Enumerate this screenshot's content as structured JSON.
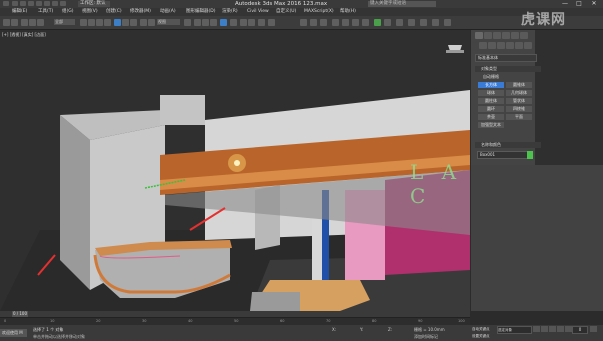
{
  "titlebar": {
    "workspace": "工作区: 默认",
    "title": "Autodesk 3ds Max 2016     123.max",
    "search_placeholder": "键入关键字或短语",
    "win_min": "—",
    "win_max": "□",
    "win_close": "✕"
  },
  "menubar": [
    "编辑(E)",
    "工具(T)",
    "组(G)",
    "视图(V)",
    "创建(C)",
    "修改器(M)",
    "动画(A)",
    "图形编辑器(D)",
    "渲染(R)",
    "Civil View",
    "自定义(U)",
    "MAXScript(X)",
    "帮助(H)"
  ],
  "toolbar": {
    "selection_filter": "全部",
    "view_dropdown": "视图"
  },
  "viewport": {
    "label": "[+] [透视] [真实] [边面]",
    "sign_text": "L A C"
  },
  "command_panel": {
    "dropdown": "标准基本体",
    "object_type_header": "对象类型",
    "autogrid": "自动栅格",
    "buttons": [
      "长方体",
      "圆锥体",
      "球体",
      "几何球体",
      "圆柱体",
      "管状体",
      "圆环",
      "四棱锥",
      "茶壶",
      "平面",
      "加强型文本"
    ],
    "selected_button": "长方体",
    "name_color_header": "名称和颜色",
    "name_value": "Box001",
    "color": "#4cc34c"
  },
  "timeline": {
    "cursor": "0 / 100",
    "ticks": [
      "0",
      "10",
      "20",
      "30",
      "40",
      "50",
      "60",
      "70",
      "80",
      "90",
      "100"
    ]
  },
  "statusbar": {
    "maxscript": "欢迎使用 M",
    "status1": "选择了 1 个 对象",
    "status2": "单击并拖动以选择并移动对象",
    "x_label": "X:",
    "y_label": "Y:",
    "z_label": "Z:",
    "grid": "栅格 = 10.0mm",
    "add_time_tag": "添加时间标记",
    "autokey": "自动关键点",
    "setkey": "设置关键点",
    "selected_object": "选定对象",
    "frame": "0"
  },
  "watermark": "虎课网"
}
